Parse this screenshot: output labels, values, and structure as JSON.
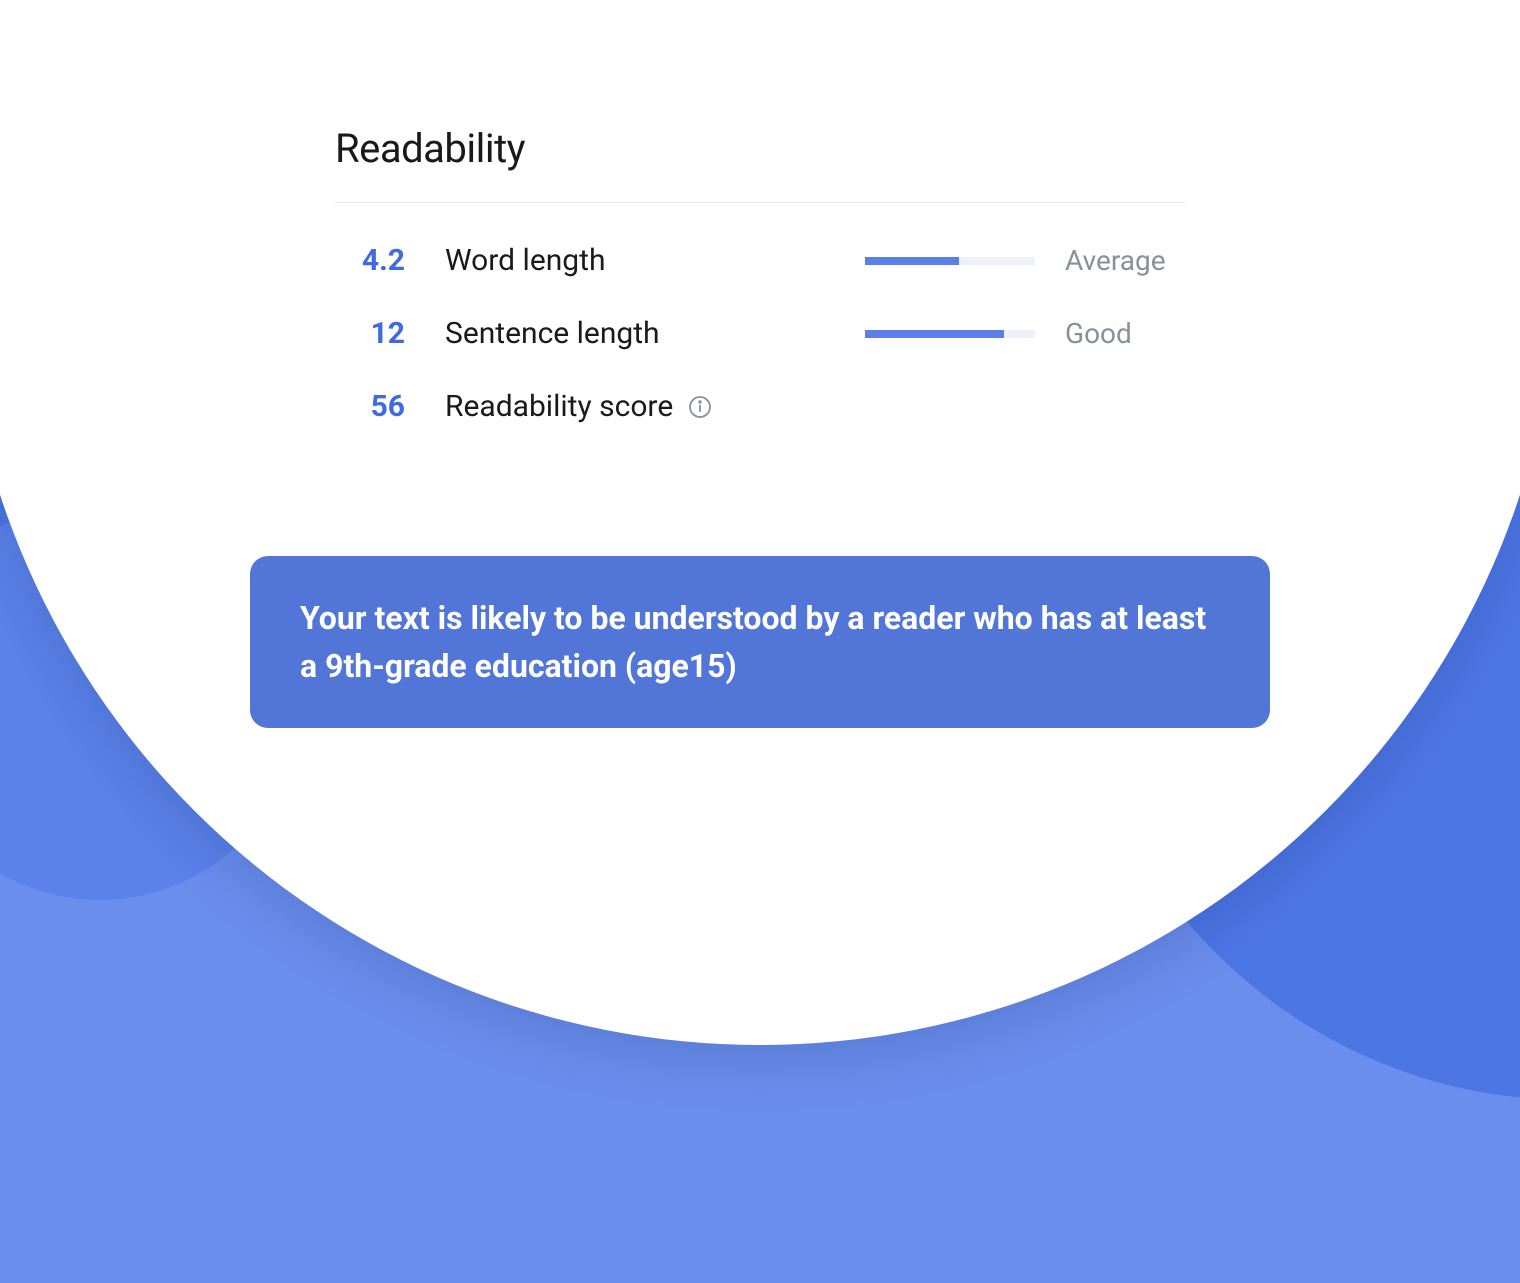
{
  "card": {
    "title": "Readability",
    "metrics": [
      {
        "value": "4.2",
        "label": "Word length",
        "rating": "Average",
        "progress_pct": 55
      },
      {
        "value": "12",
        "label": "Sentence length",
        "rating": "Good",
        "progress_pct": 82
      },
      {
        "value": "56",
        "label": "Readability score",
        "rating": "",
        "has_info": true
      }
    ]
  },
  "summary": "Your text is likely to be understood by a reader who has at least a 9th-grade education (age15)"
}
